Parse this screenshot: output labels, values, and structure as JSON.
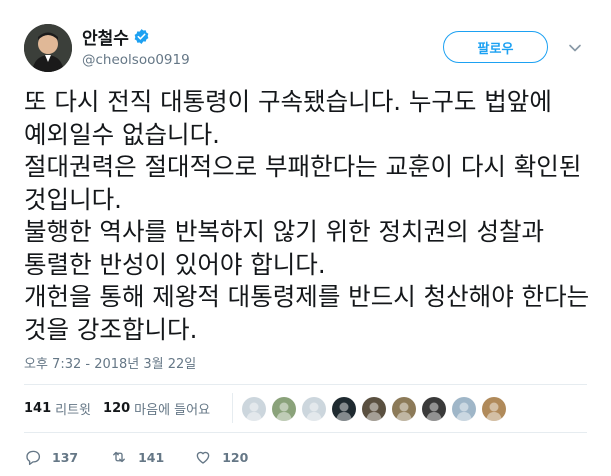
{
  "author": {
    "display_name": "안철수",
    "handle": "@cheolsoo0919",
    "verified": true
  },
  "follow_button": {
    "label": "팔로우"
  },
  "tweet": {
    "text": "또 다시 전직 대통령이 구속됐습니다. 누구도 법앞에 예외일수 없습니다.\n절대권력은 절대적으로 부패한다는 교훈이 다시 확인된 것입니다.\n불행한 역사를 반복하지 않기 위한 정치권의 성찰과 통렬한 반성이 있어야 합니다.\n개헌을 통해 제왕적 대통령제를 반드시 청산해야 한다는 것을 강조합니다.",
    "timestamp": "오후 7:32 - 2018년 3월 22일"
  },
  "stats": {
    "retweets_count": "141",
    "retweets_label": "리트윗",
    "likes_count": "120",
    "likes_label": "마음에 들어요"
  },
  "likers": [
    {
      "name": "liker-1",
      "color": "#ccd6dd"
    },
    {
      "name": "liker-2",
      "color": "#8aa27a"
    },
    {
      "name": "liker-3",
      "color": "#ccd6dd"
    },
    {
      "name": "liker-4",
      "color": "#1f2a30"
    },
    {
      "name": "liker-5",
      "color": "#5a5040"
    },
    {
      "name": "liker-6",
      "color": "#8c7a58"
    },
    {
      "name": "liker-7",
      "color": "#3a3a3a"
    },
    {
      "name": "liker-8",
      "color": "#9fb6c8"
    },
    {
      "name": "liker-9",
      "color": "#b08a5a"
    }
  ],
  "actions": {
    "reply_count": "137",
    "retweet_count": "141",
    "like_count": "120"
  },
  "colors": {
    "accent": "#1da1f2",
    "text": "#14171a",
    "muted": "#657786",
    "border": "#e6ecf0"
  }
}
